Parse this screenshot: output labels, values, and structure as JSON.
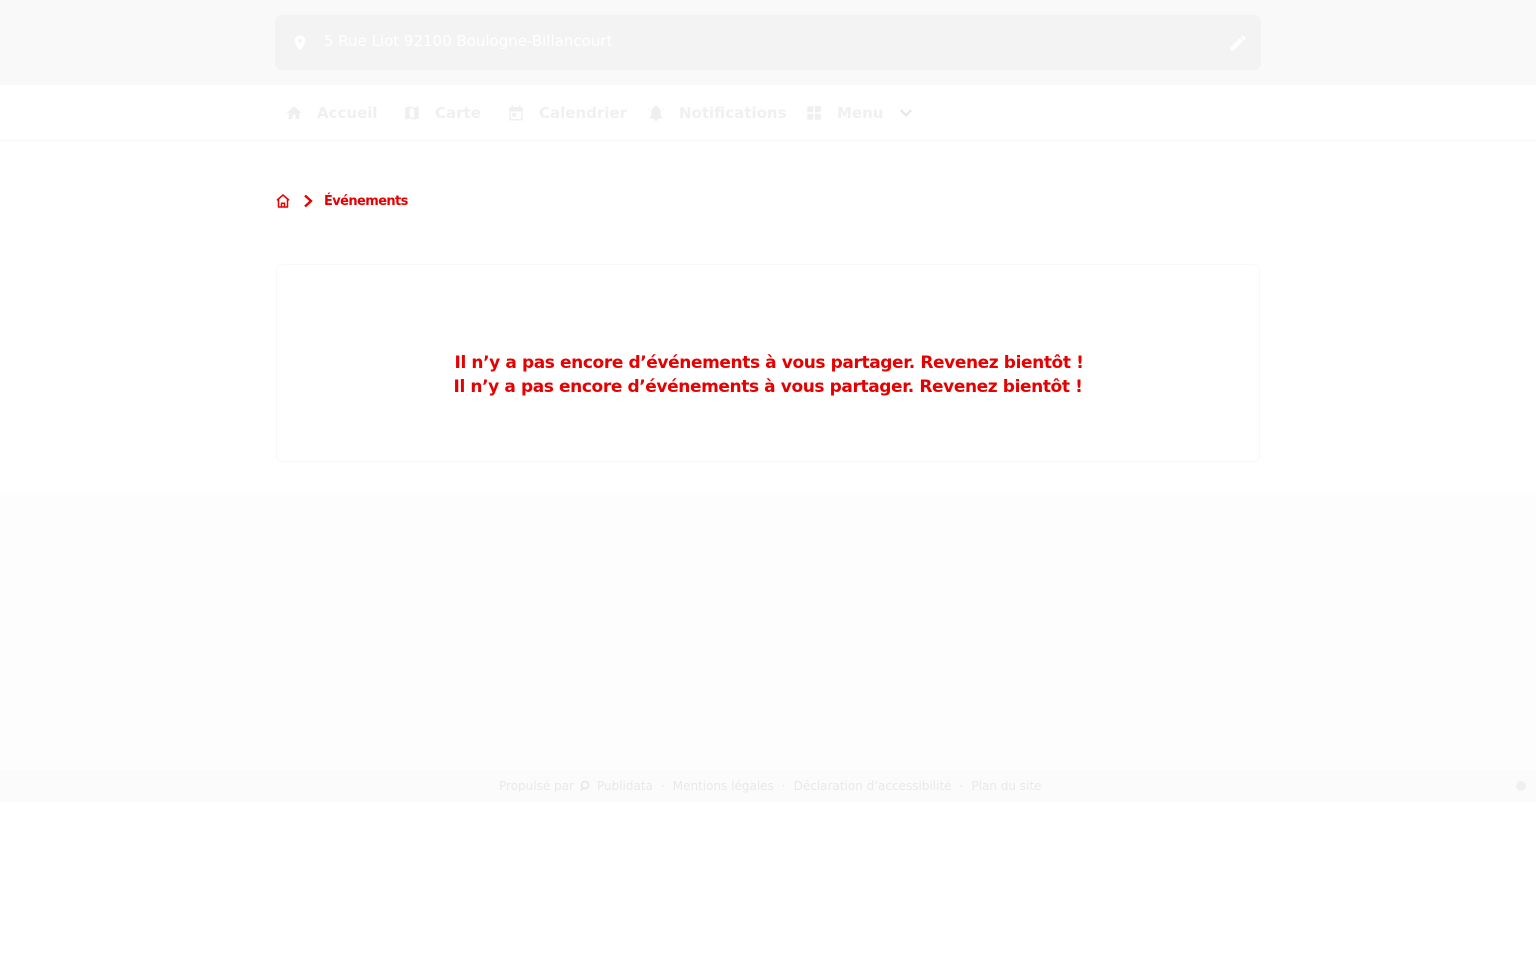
{
  "header": {
    "address": "5 Rue Liot 92100 Boulogne-Billancourt",
    "icons": {
      "location": "map-pin-icon",
      "edit": "pencil-icon"
    }
  },
  "nav": {
    "items": [
      {
        "label": "Accueil",
        "icon": "home-icon"
      },
      {
        "label": "Carte",
        "icon": "map-icon"
      },
      {
        "label": "Calendrier",
        "icon": "calendar-icon"
      },
      {
        "label": "Notifications",
        "icon": "alarm-icon"
      },
      {
        "label": "Menu",
        "icon": "grid-icon"
      }
    ]
  },
  "breadcrumb": {
    "current": "Événements"
  },
  "empty_state": {
    "line1": "Il n’y a pas encore d’événements à vous partager. Revenez bientôt !",
    "line2": "Il n’y a pas encore d’événements à vous partager. Revenez bientôt !"
  },
  "footer": {
    "powered_by": "Propulsé par",
    "brand": "Publidata",
    "legal": "Mentions légales",
    "accessibility": "Déclaration d’accessibilité",
    "sitemap": "Plan du site"
  },
  "colors": {
    "accent": "#e60000",
    "topbar_bg": "#f9f9f9",
    "address_bg": "#f3f3f3",
    "nav_text": "#f0f0f0"
  }
}
